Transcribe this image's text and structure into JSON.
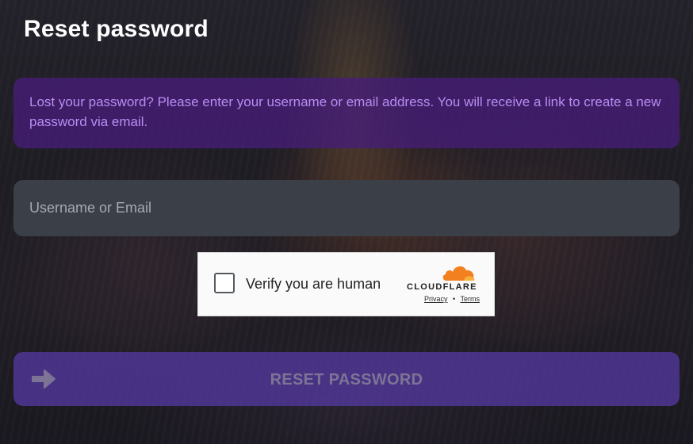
{
  "page": {
    "title": "Reset password"
  },
  "notice": {
    "text": "Lost your password? Please enter your username or email address. You will receive a link to create a new password via email."
  },
  "form": {
    "username_placeholder": "Username or Email",
    "username_value": ""
  },
  "captcha": {
    "label": "Verify you are human",
    "brand": "CLOUDFLARE",
    "privacy_link": "Privacy",
    "separator": "•",
    "terms_link": "Terms",
    "checked": false
  },
  "submit": {
    "label": "RESET PASSWORD",
    "icon": "arrow-right-icon"
  },
  "colors": {
    "notice_bg": "#46207a",
    "notice_text": "#b98cf2",
    "input_bg": "#3a3f48",
    "button_bg": "#583aa8",
    "cloudflare_orange": "#f38020"
  }
}
